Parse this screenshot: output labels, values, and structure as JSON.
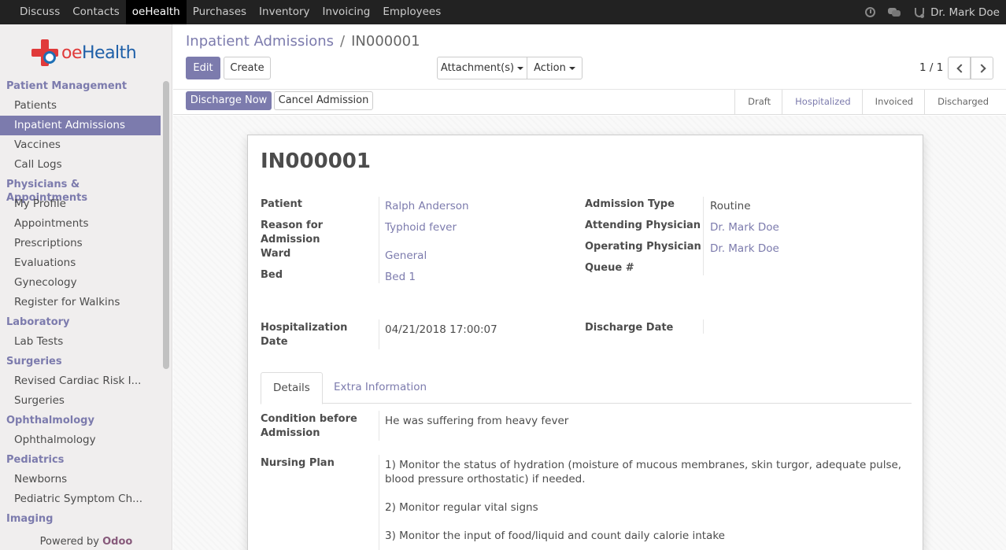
{
  "topbar": {
    "menu": [
      "Discuss",
      "Contacts",
      "oeHealth",
      "Purchases",
      "Inventory",
      "Invoicing",
      "Employees"
    ],
    "active": "oeHealth",
    "user": "Dr. Mark Doe",
    "icons": [
      "clock-icon",
      "chat-icon",
      "stethoscope-icon"
    ]
  },
  "sidebar": {
    "logo_text_a": "oe",
    "logo_text_b": "Health",
    "sections": [
      {
        "title": "Patient Management",
        "items": [
          "Patients",
          "Inpatient Admissions",
          "Vaccines",
          "Call Logs"
        ]
      },
      {
        "title": "Physicians & Appointments",
        "items": [
          "My Profile",
          "Appointments",
          "Prescriptions",
          "Evaluations",
          "Gynecology",
          "Register for Walkins"
        ]
      },
      {
        "title": "Laboratory",
        "items": [
          "Lab Tests"
        ]
      },
      {
        "title": "Surgeries",
        "items": [
          "Revised Cardiac Risk I...",
          "Surgeries"
        ]
      },
      {
        "title": "Ophthalmology",
        "items": [
          "Ophthalmology"
        ]
      },
      {
        "title": "Pediatrics",
        "items": [
          "Newborns",
          "Pediatric Symptom Ch..."
        ]
      },
      {
        "title": "Imaging",
        "items": []
      }
    ],
    "active_item": "Inpatient Admissions",
    "powered_prefix": "Powered by ",
    "powered_brand": "Odoo"
  },
  "control": {
    "breadcrumb_parent": "Inpatient Admissions",
    "breadcrumb_sep": "/",
    "breadcrumb_current": "IN000001",
    "edit_label": "Edit",
    "create_label": "Create",
    "attachments_label": "Attachment(s)",
    "action_label": "Action",
    "pager": "1 / 1"
  },
  "statusbar": {
    "discharge_label": "Discharge Now",
    "cancel_label": "Cancel Admission",
    "stages": [
      "Draft",
      "Hospitalized",
      "Invoiced",
      "Discharged"
    ],
    "active_stage": "Hospitalized"
  },
  "form": {
    "title": "IN000001",
    "left": {
      "patient_label": "Patient",
      "patient_value": "Ralph Anderson",
      "reason_label_1": "Reason for",
      "reason_label_2": "Admission",
      "reason_value": "Typhoid fever",
      "ward_label": "Ward",
      "ward_value": "General",
      "bed_label": "Bed",
      "bed_value": "Bed 1",
      "hosp_label_1": "Hospitalization",
      "hosp_label_2": "Date",
      "hosp_value": "04/21/2018 17:00:07"
    },
    "right": {
      "type_label": "Admission Type",
      "type_value": "Routine",
      "attending_label": "Attending Physician",
      "attending_value": "Dr. Mark Doe",
      "operating_label": "Operating Physician",
      "operating_value": "Dr. Mark Doe",
      "queue_label": "Queue #",
      "discharge_date_label": "Discharge Date"
    },
    "tabs": [
      "Details",
      "Extra Information"
    ],
    "active_tab": "Details",
    "details": {
      "condition_label_1": "Condition before",
      "condition_label_2": "Admission",
      "condition_value": "He was suffering from heavy fever",
      "nursing_label": "Nursing Plan",
      "nursing_1a": "1) Monitor the status of hydration (moisture of mucous membranes, skin turgor, adequate pulse,",
      "nursing_1b": "blood pressure orthostatic) if needed.",
      "nursing_2": "2) Monitor regular vital signs",
      "nursing_3": "3) Monitor the input of food/liquid and count daily calorie intake"
    }
  }
}
